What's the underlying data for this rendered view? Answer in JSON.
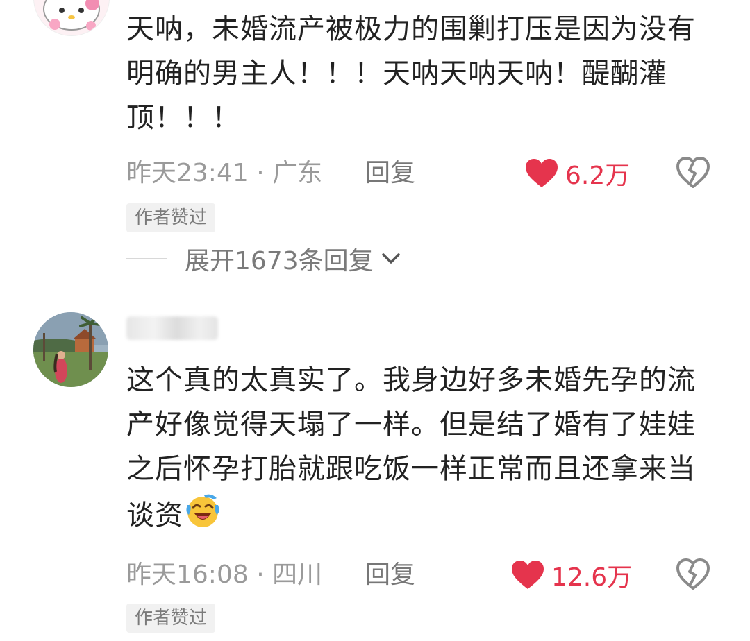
{
  "comments": [
    {
      "text": "天呐，未婚流产被极力的围剿打压是因为没有明确的男主人！！！天呐天呐天呐！醍醐灌顶！！！",
      "time_location": "昨天23:41 · 广东",
      "reply_label": "回复",
      "like_count": "6.2万",
      "badge": "作者赞过",
      "expand_label": "展开1673条回复",
      "avatar_icon": "cartoon-cat-avatar-icon"
    },
    {
      "username": "",
      "text": "这个真的太真实了。我身边好多未婚先孕的流产好像觉得天塌了一样。但是结了婚有了娃娃之后怀孕打胎就跟吃饭一样正常而且还拿来当谈资",
      "emoji": "laughing-crying-emoji",
      "time_location": "昨天16:08 · 四川",
      "reply_label": "回复",
      "like_count": "12.6万",
      "badge": "作者赞过",
      "avatar_icon": "photo-avatar-icon"
    }
  ],
  "colors": {
    "like": "#e5344d",
    "meta_text": "#9a9a9a",
    "body_text": "#222222",
    "badge_bg": "#f1f1f1"
  },
  "icons": {
    "like": "heart-icon",
    "dislike": "broken-heart-icon",
    "expand": "chevron-down-icon"
  }
}
